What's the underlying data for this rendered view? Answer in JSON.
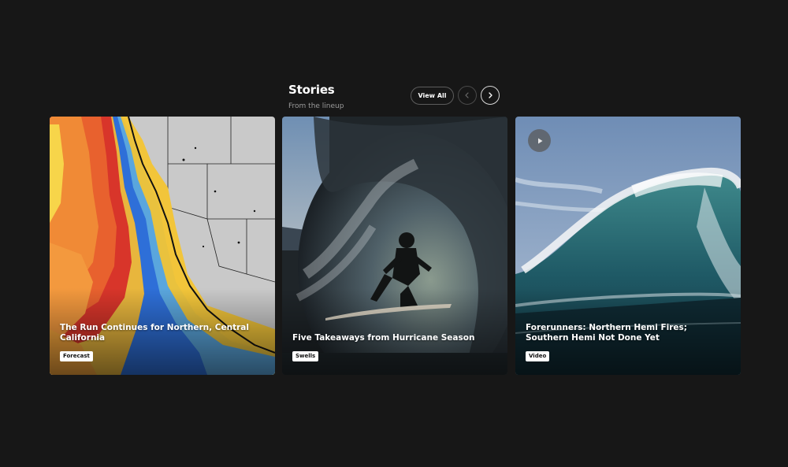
{
  "section": {
    "title": "Stories",
    "subtitle": "From the lineup"
  },
  "controls": {
    "view_all_label": "View All",
    "prev_icon": "chevron-left-icon",
    "next_icon": "chevron-right-icon"
  },
  "cards": [
    {
      "title": "The Run Continues for Northern, Central California",
      "tag": "Forecast",
      "image": "swell-forecast-map"
    },
    {
      "title": "Five Takeaways from Hurricane Season",
      "tag": "Swells",
      "image": "surfer-in-barrel"
    },
    {
      "title": "Forerunners: Northern Hemi Fires; Southern Hemi Not Done Yet",
      "tag": "Video",
      "image": "breaking-wave",
      "has_play_icon": true
    }
  ],
  "colors": {
    "background": "#171717",
    "tag_bg": "#ffffff",
    "subtitle": "#9a9a9a"
  }
}
